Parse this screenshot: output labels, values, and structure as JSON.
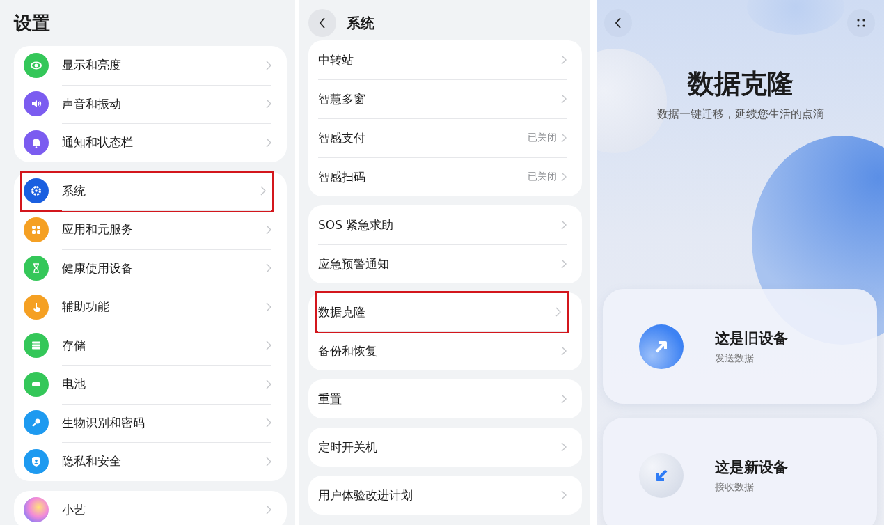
{
  "settings": {
    "title": "设置",
    "groups": [
      {
        "items": [
          {
            "label": "显示和亮度",
            "highlighted": false
          },
          {
            "label": "声音和振动",
            "highlighted": false
          },
          {
            "label": "通知和状态栏",
            "highlighted": false
          }
        ]
      },
      {
        "items": [
          {
            "label": "系统",
            "highlighted": true
          },
          {
            "label": "应用和元服务",
            "highlighted": false
          },
          {
            "label": "健康使用设备",
            "highlighted": false
          },
          {
            "label": "辅助功能",
            "highlighted": false
          },
          {
            "label": "存储",
            "highlighted": false
          },
          {
            "label": "电池",
            "highlighted": false
          },
          {
            "label": "生物识别和密码",
            "highlighted": false
          },
          {
            "label": "隐私和安全",
            "highlighted": false
          }
        ]
      },
      {
        "items": [
          {
            "label": "小艺",
            "highlighted": false
          }
        ]
      }
    ]
  },
  "system": {
    "title": "系统",
    "groups": [
      {
        "items": [
          {
            "label": "中转站",
            "highlighted": false
          },
          {
            "label": "智慧多窗",
            "highlighted": false
          },
          {
            "label": "智感支付",
            "value": "已关闭",
            "highlighted": false
          },
          {
            "label": "智感扫码",
            "value": "已关闭",
            "highlighted": false
          }
        ]
      },
      {
        "items": [
          {
            "label": "SOS 紧急求助",
            "highlighted": false
          },
          {
            "label": "应急预警通知",
            "highlighted": false
          }
        ]
      },
      {
        "items": [
          {
            "label": "数据克隆",
            "highlighted": true
          },
          {
            "label": "备份和恢复",
            "highlighted": false
          }
        ]
      },
      {
        "items": [
          {
            "label": "重置",
            "highlighted": false
          }
        ]
      },
      {
        "items": [
          {
            "label": "定时开关机",
            "highlighted": false
          }
        ]
      },
      {
        "items": [
          {
            "label": "用户体验改进计划",
            "highlighted": false
          }
        ]
      }
    ]
  },
  "clone": {
    "title": "数据克隆",
    "subtitle": "数据一键迁移，延续您生活的点滴",
    "options": [
      {
        "kind": "send",
        "title": "这是旧设备",
        "subtitle": "发送数据"
      },
      {
        "kind": "receive",
        "title": "这是新设备",
        "subtitle": "接收数据"
      }
    ]
  }
}
